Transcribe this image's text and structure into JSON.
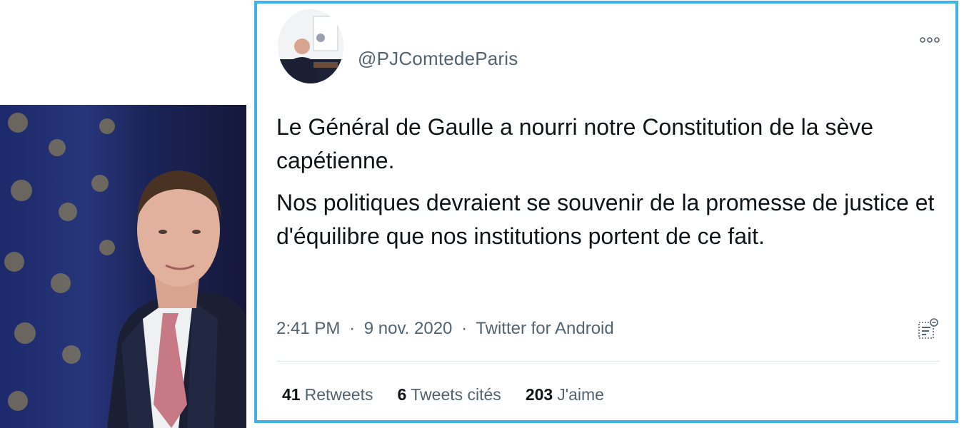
{
  "tweet": {
    "handle": "@PJComtedeParis",
    "paragraphs": [
      "Le Général de Gaulle a nourri notre Constitution de la sève capétienne.",
      "Nos politiques devraient se souvenir de la promesse de justice et d'équilibre que nos institutions portent de ce fait."
    ],
    "time": "2:41 PM",
    "separator": "·",
    "date": "9 nov. 2020",
    "source": "Twitter for Android",
    "more_icon": "more-icon",
    "analytics_icon": "analytics-icon"
  },
  "stats": {
    "retweets_count": "41",
    "retweets_label": "Retweets",
    "quotes_count": "6",
    "quotes_label": "Tweets cités",
    "likes_count": "203",
    "likes_label": "J'aime"
  },
  "colors": {
    "border": "#3fb2ea",
    "secondary_text": "#536471",
    "primary_text": "#0f1419"
  }
}
